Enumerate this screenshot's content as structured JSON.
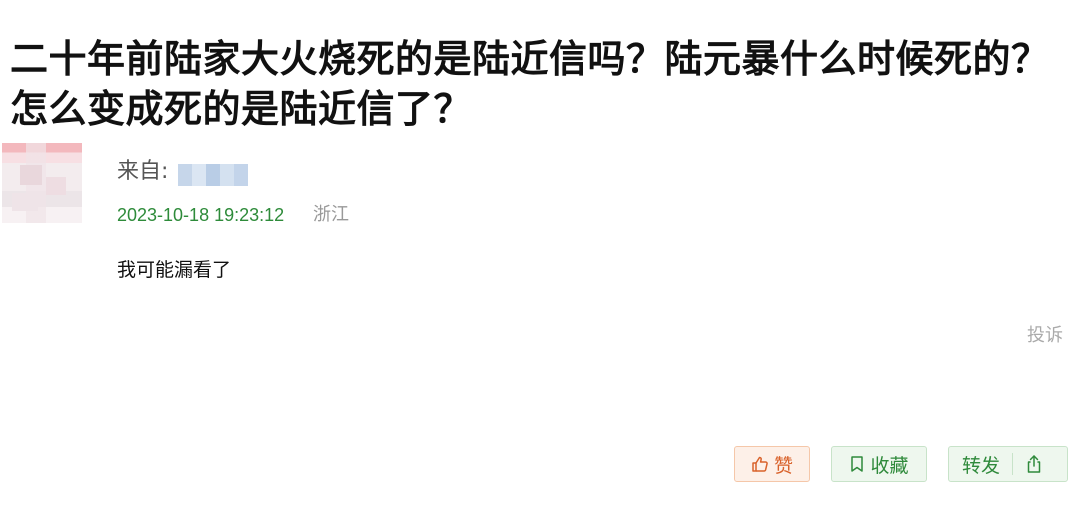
{
  "question": {
    "title": "二十年前陆家大火烧死的是陆近信吗？陆元暴什么时候死的？怎么变成死的是陆近信了？"
  },
  "answer": {
    "from_label": "来自:",
    "timestamp": "2023-10-18 19:23:12",
    "location": "浙江",
    "content": "我可能漏看了",
    "report_label": "投诉"
  },
  "actions": {
    "like_label": "赞",
    "favorite_label": "收藏",
    "share_label": "转发"
  },
  "colors": {
    "green": "#2f8a3b",
    "orange": "#d9622b"
  }
}
